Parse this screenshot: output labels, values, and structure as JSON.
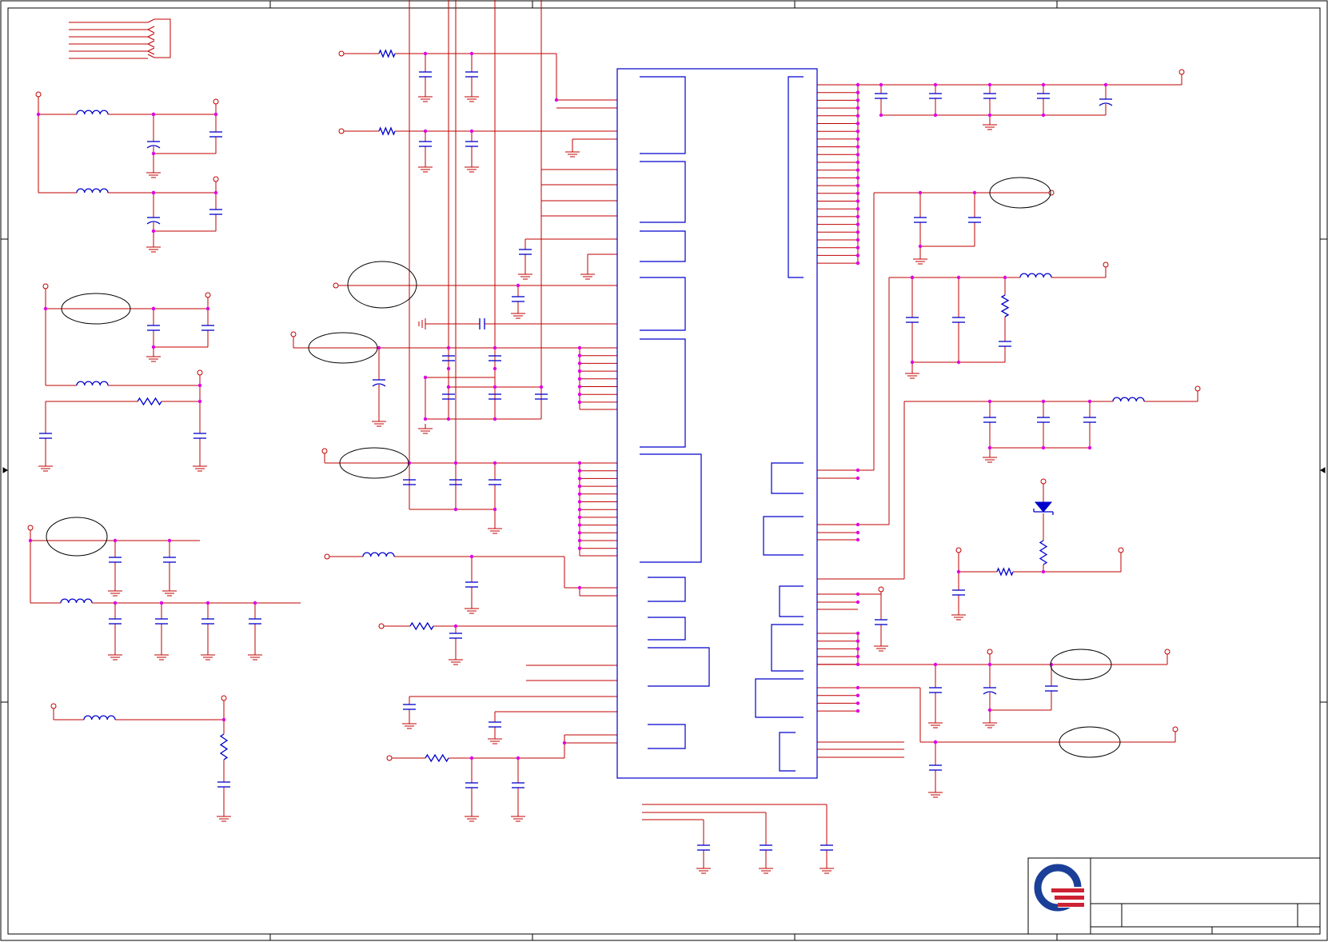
{
  "colors": {
    "border": "#000000",
    "wire": "#c00000",
    "component": "#0000cc",
    "junction": "#e000e0",
    "callout": "#000000",
    "logo_blue": "#1a3f99",
    "logo_red": "#cc2233"
  },
  "title_block": {
    "logo": "company-logo"
  }
}
